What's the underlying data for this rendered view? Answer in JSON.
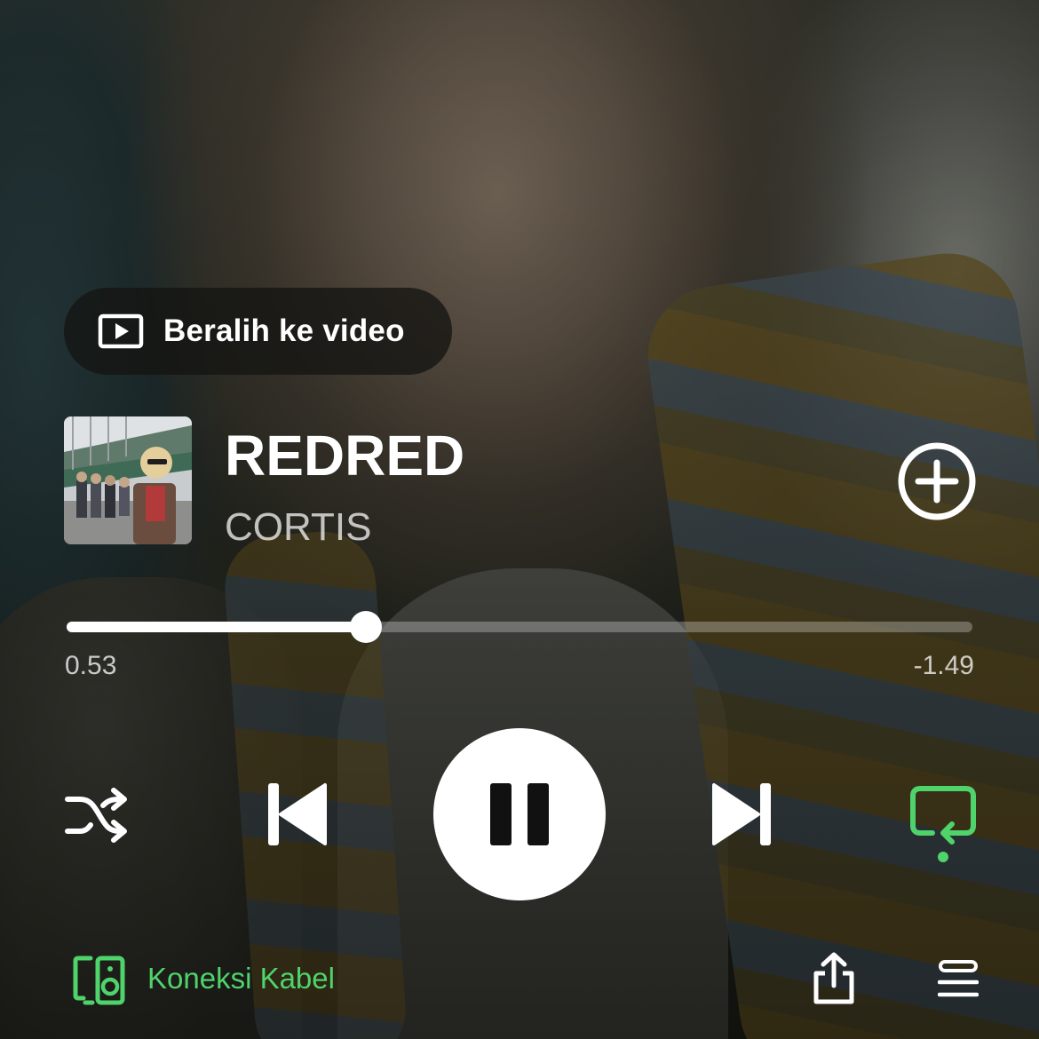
{
  "video_toggle": {
    "label": "Beralih ke video",
    "icon": "play-box-icon"
  },
  "track": {
    "title": "REDRED",
    "artist": "CORTIS",
    "art_icon": "album-art"
  },
  "progress": {
    "elapsed": "0.53",
    "remaining": "-1.49",
    "fraction": 0.33
  },
  "controls": {
    "shuffle_icon": "shuffle-icon",
    "previous_icon": "skip-previous-icon",
    "play_state": "playing",
    "pause_icon": "pause-icon",
    "next_icon": "skip-next-icon",
    "repeat_icon": "repeat-icon",
    "repeat_active": true
  },
  "output": {
    "device_label": "Koneksi Kabel",
    "device_icon": "speaker-device-icon"
  },
  "actions": {
    "share_icon": "share-icon",
    "queue_icon": "queue-icon",
    "add_icon": "add-circle-icon"
  },
  "colors": {
    "accent_green": "#4fd36b",
    "text_primary": "#ffffff",
    "text_secondary": "rgba(255,255,255,0.72)"
  }
}
